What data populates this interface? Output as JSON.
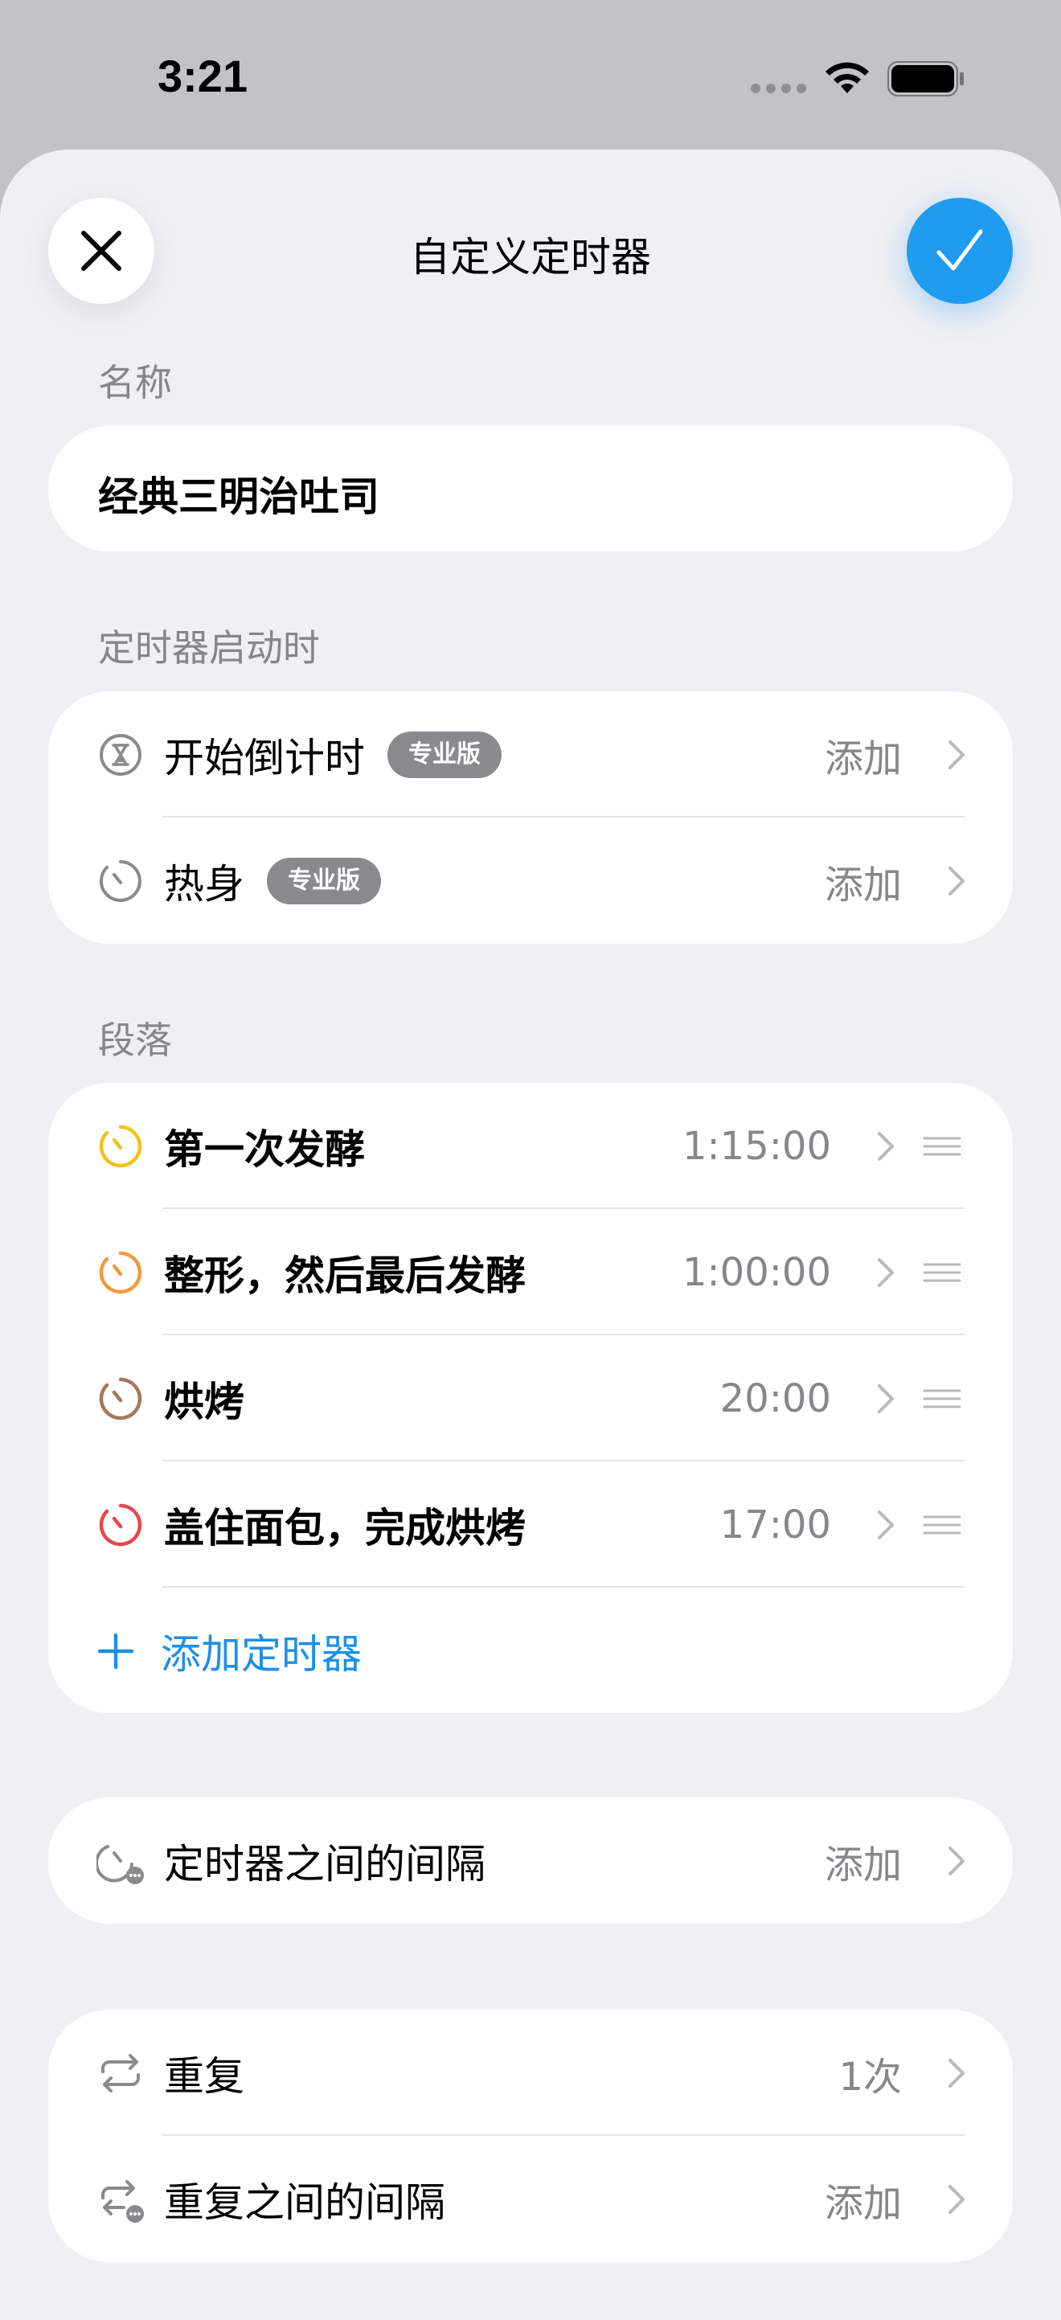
{
  "status_bar": {
    "time": "3:21",
    "wifi_icon": "wifi-icon",
    "battery_icon": "battery-icon"
  },
  "header": {
    "title": "自定义定时器",
    "close_icon": "close-icon",
    "done_icon": "checkmark-icon",
    "accent": "#1f9bf0"
  },
  "name_section": {
    "label": "名称",
    "value": "经典三明治吐司"
  },
  "start_section": {
    "label": "定时器启动时",
    "rows": [
      {
        "label": "开始倒计时",
        "badge": "专业版",
        "value": "添加",
        "icon": "hourglass-icon"
      },
      {
        "label": "热身",
        "badge": "专业版",
        "value": "添加",
        "icon": "timer-icon"
      }
    ]
  },
  "segments_section": {
    "label": "段落",
    "rows": [
      {
        "label": "第一次发酵",
        "value": "1:15:00",
        "icon": "timer-icon",
        "color": "#f2c21b"
      },
      {
        "label": "整形，然后最后发酵",
        "value": "1:00:00",
        "icon": "timer-icon",
        "color": "#f29a3a"
      },
      {
        "label": "烘烤",
        "value": "20:00",
        "icon": "timer-icon",
        "color": "#a5785a"
      },
      {
        "label": "盖住面包，完成烘烤",
        "value": "17:00",
        "icon": "timer-icon",
        "color": "#e5484d"
      }
    ],
    "add_label": "添加定时器",
    "add_color": "#1f8fe6"
  },
  "interval_section": {
    "label": "定时器之间的间隔",
    "value": "添加",
    "icon": "timer-interval-icon"
  },
  "repeat_section": {
    "rows": [
      {
        "label": "重复",
        "value": "1次",
        "icon": "repeat-icon"
      },
      {
        "label": "重复之间的间隔",
        "value": "添加",
        "icon": "repeat-interval-icon"
      }
    ]
  }
}
